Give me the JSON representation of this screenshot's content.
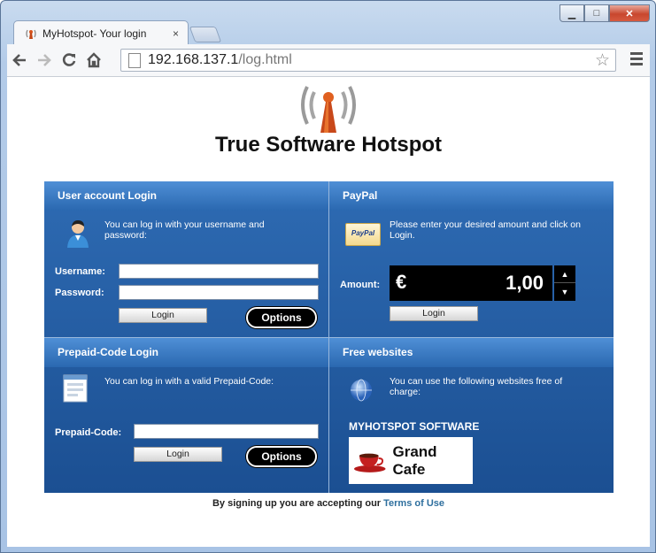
{
  "browser": {
    "tab_title": "MyHotspot- Your login",
    "tab_close": "×",
    "url_host": "192.168.137.1",
    "url_path": "/log.html",
    "window_buttons": {
      "minimize": "▁",
      "maximize": "□",
      "close": "✕"
    },
    "nav_icons": [
      "back-icon",
      "forward-icon",
      "reload-icon",
      "home-icon"
    ]
  },
  "page": {
    "title": "True Software Hotspot",
    "user_login": {
      "header": "User account Login",
      "description": "You can log in with  your username  and password:",
      "username_label": "Username:",
      "password_label": "Password:",
      "username_value": "",
      "password_value": "",
      "login_button": "Login",
      "options_button": "Options"
    },
    "paypal": {
      "header": "PayPal",
      "logo_text": "PayPal",
      "description": "Please enter your desired amount and click on Login.",
      "amount_label": "Amount:",
      "currency": "€",
      "amount_value": "1,00",
      "login_button": "Login"
    },
    "prepaid": {
      "header": "Prepaid-Code Login",
      "description": "You can log in with a valid Prepaid-Code:",
      "code_label": "Prepaid-Code:",
      "code_value": "",
      "login_button": "Login",
      "options_button": "Options"
    },
    "free_websites": {
      "header": "Free websites",
      "description": "You can use the  following websites  free of charge:",
      "site_title": "MYHOTSPOT SOFTWARE",
      "site_name": "Grand Cafe"
    },
    "footer": {
      "text": "By signing up you are accepting our ",
      "link": "Terms of Use"
    }
  },
  "colors": {
    "panel_blue": "#2e6bb3",
    "header_blue": "#4f8fd6",
    "link": "#2e6f9e",
    "amount_bg": "#000000"
  }
}
